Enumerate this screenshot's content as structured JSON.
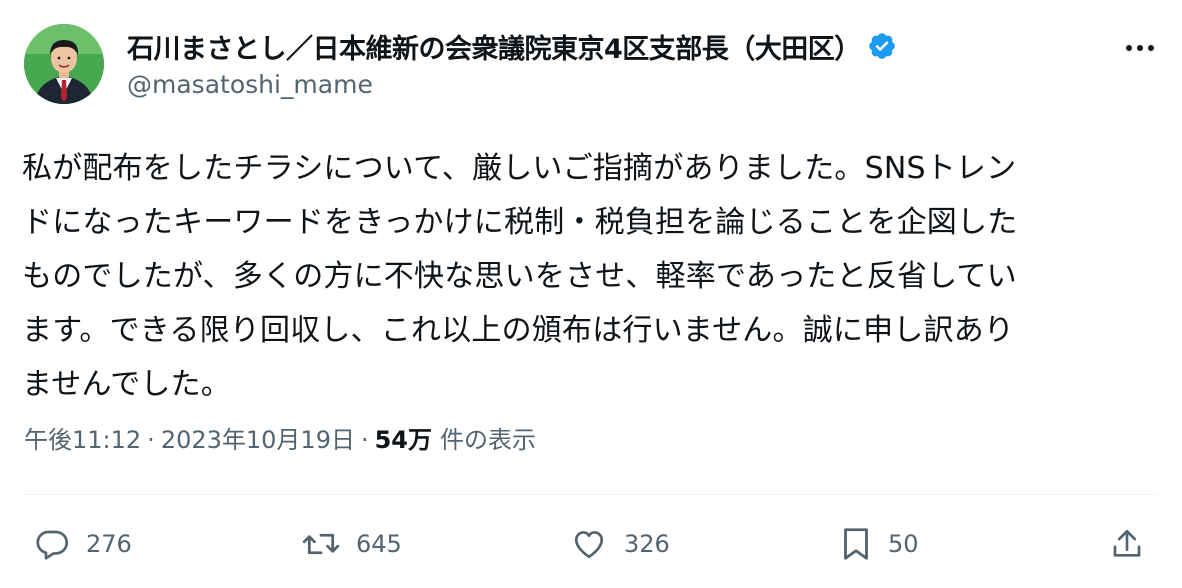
{
  "author": {
    "display_name": "石川まさとし／日本維新の会衆議院東京4区支部長（大田区）",
    "handle": "@masatoshi_mame",
    "verified": true
  },
  "tweet": {
    "text": "私が配布をしたチラシについて、厳しいご指摘がありました。SNSトレン\nドになったキーワードをきっかけに税制・税負担を論じることを企図した\nものでしたが、多くの方に不快な思いをさせ、軽率であったと反省してい\nます。できる限り回収し、これ以上の頒布は行いません。誠に申し訳あり\nませんでした。",
    "time": "午後11:12",
    "date": "2023年10月19日",
    "separator": "·",
    "views_count": "54万",
    "views_label": "件の表示"
  },
  "actions": {
    "replies": "276",
    "reposts": "645",
    "likes": "326",
    "bookmarks": "50"
  },
  "icons": {
    "verified": "verified-badge-icon",
    "more": "more-dots-icon",
    "reply": "reply-bubble-icon",
    "repost": "repost-arrows-icon",
    "like": "heart-icon",
    "bookmark": "bookmark-icon",
    "share": "share-upload-icon"
  },
  "colors": {
    "text_primary": "#0f1419",
    "text_secondary": "#536471",
    "verified_blue": "#1d9bf0",
    "avatar_bg": "#3fa34a"
  }
}
